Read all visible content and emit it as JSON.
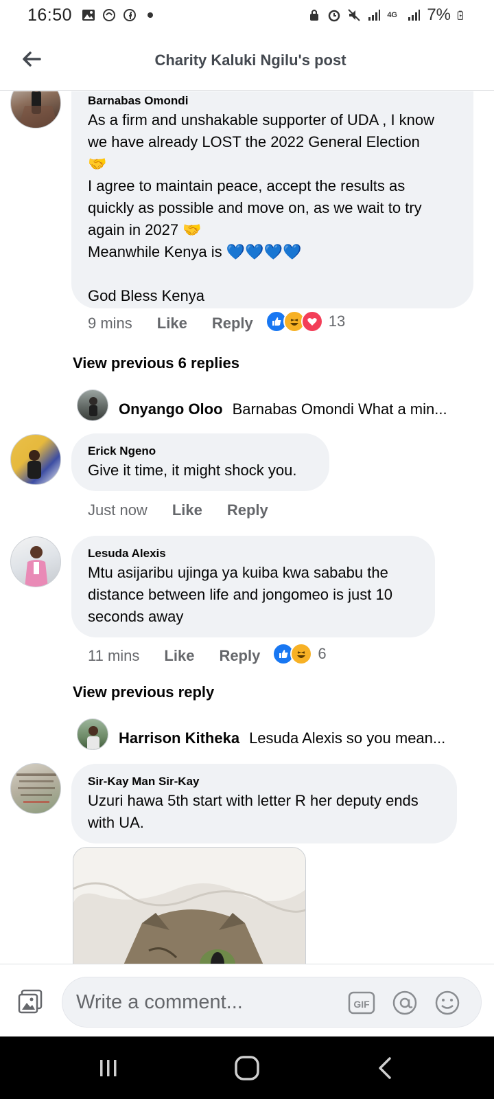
{
  "status_bar": {
    "time": "16:50",
    "battery": "7%",
    "network": "4G"
  },
  "header": {
    "title": "Charity Kaluki Ngilu's post"
  },
  "comments": [
    {
      "author": "Barnabas Omondi",
      "lines": [
        "As a firm and unshakable supporter of UDA , I know",
        "we have already LOST the 2022 General Election",
        "🤝",
        "I agree to maintain peace, accept the results as",
        "quickly as possible and move on, as we wait to try",
        "again in 2027 🤝",
        "Meanwhile Kenya is 💙💙💙💙",
        "",
        "God Bless Kenya"
      ],
      "time": "9 mins",
      "like_label": "Like",
      "reply_label": "Reply",
      "reactions": [
        "like",
        "haha",
        "love"
      ],
      "reaction_count": "13"
    },
    {
      "author": "Erick Ngeno",
      "lines": [
        "Give it time, it might shock you."
      ],
      "time": "Just now",
      "like_label": "Like",
      "reply_label": "Reply"
    },
    {
      "author": "Lesuda Alexis",
      "lines": [
        "Mtu asijaribu ujinga ya kuiba kwa sababu the",
        "distance between life and jongomeo is just 10",
        "seconds away"
      ],
      "time": "11 mins",
      "like_label": "Like",
      "reply_label": "Reply",
      "reactions": [
        "like",
        "haha"
      ],
      "reaction_count": "6"
    },
    {
      "author": "Sir-Kay Man Sir-Kay",
      "lines": [
        "Uzuri hawa 5th start with letter R her deputy ends",
        "with UA."
      ]
    }
  ],
  "view_previous": [
    {
      "label": "View previous 6 replies"
    },
    {
      "label": "View previous reply"
    }
  ],
  "reply_previews": [
    {
      "name": "Onyango Oloo",
      "text": "Barnabas Omondi What a min..."
    },
    {
      "name": "Harrison Kitheka",
      "text": "Lesuda Alexis so you mean..."
    }
  ],
  "composer": {
    "placeholder": "Write a comment...",
    "gif_label": "GIF"
  },
  "colors": {
    "like_blue": "#1877f2",
    "love_red": "#f33e58",
    "haha_yellow": "#f7b125",
    "bubble_bg": "#f0f2f5"
  }
}
